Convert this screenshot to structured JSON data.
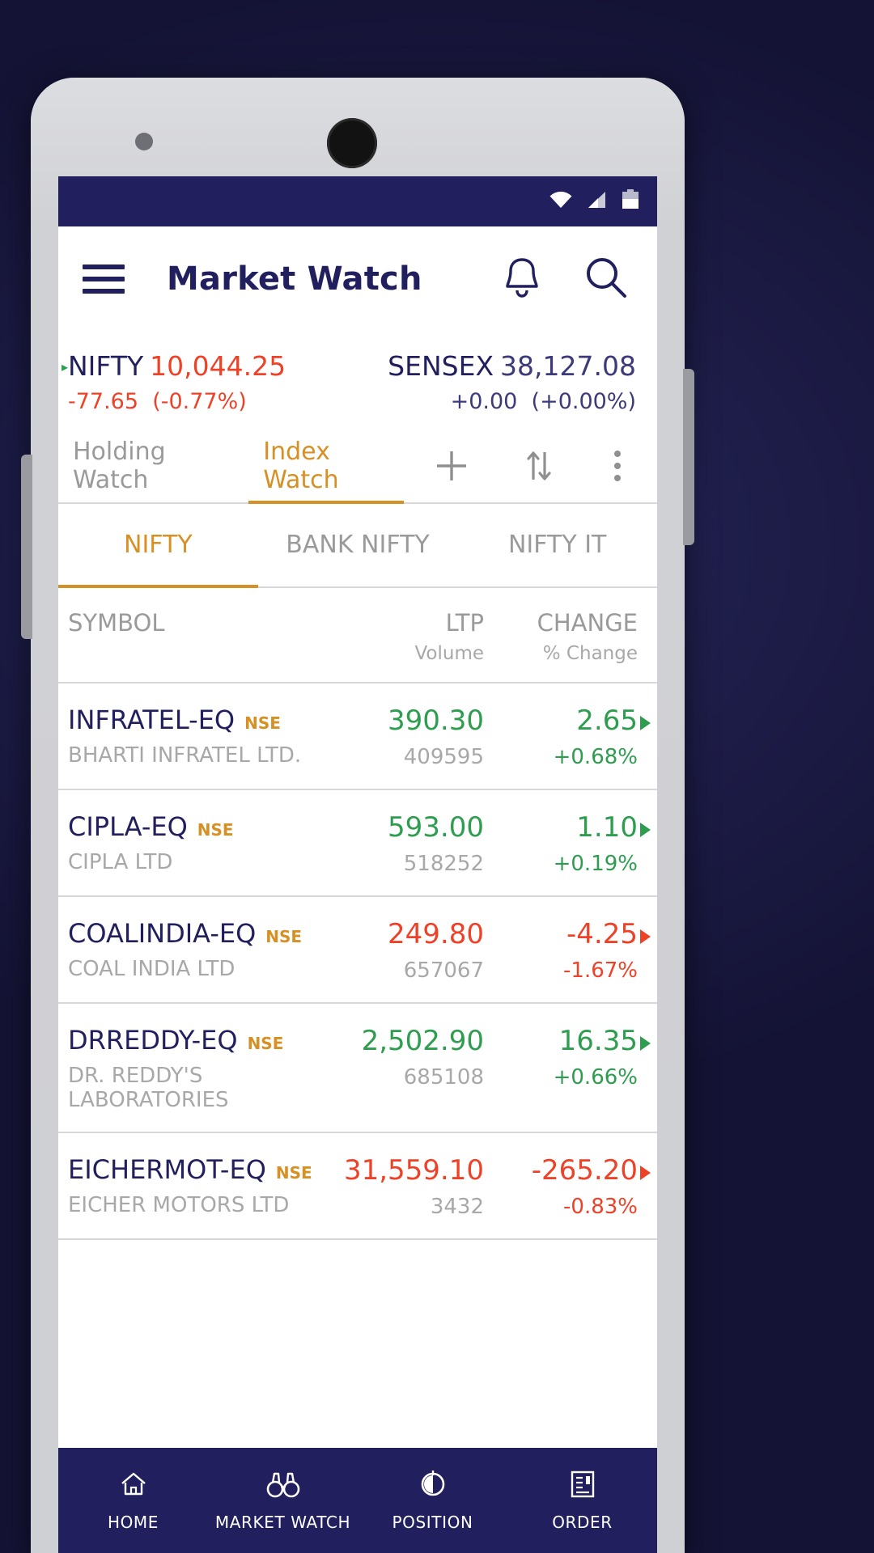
{
  "statusbar": {
    "icons": [
      "wifi-icon",
      "signal-icon",
      "battery-icon"
    ]
  },
  "appbar": {
    "title": "Market Watch",
    "menu_icon": "hamburger-icon",
    "bell_icon": "bell-icon",
    "search_icon": "search-icon"
  },
  "ticker": {
    "nifty": {
      "name": "NIFTY",
      "value": "10,044.25",
      "change": "-77.65",
      "percent": "(-0.77%)"
    },
    "sensex": {
      "name": "SENSEX",
      "value": "38,127.08",
      "change": "+0.00",
      "percent": "(+0.00%)"
    }
  },
  "watch_tabs": {
    "holding": "Holding Watch",
    "index": "Index Watch",
    "add_icon": "plus-icon",
    "sort_icon": "sort-arrows-icon",
    "more_icon": "more-vertical-icon"
  },
  "index_tabs": [
    {
      "label": "NIFTY",
      "active": true
    },
    {
      "label": "BANK NIFTY",
      "active": false
    },
    {
      "label": "NIFTY IT",
      "active": false
    }
  ],
  "columns": {
    "symbol": "SYMBOL",
    "ltp": "LTP",
    "volume": "Volume",
    "change": "CHANGE",
    "pct_change": "% Change"
  },
  "colors": {
    "brand_navy": "#211f5e",
    "accent_orange": "#d79024",
    "up_green": "#2e9d4f",
    "down_red": "#ee4228",
    "muted_grey": "#a8a8a8"
  },
  "rows": [
    {
      "symbol": "INFRATEL-EQ",
      "exchange": "NSE",
      "name": "BHARTI INFRATEL LTD.",
      "ltp": "390.30",
      "volume": "409595",
      "change": "2.65",
      "pct": "+0.68%",
      "dir": "up"
    },
    {
      "symbol": "CIPLA-EQ",
      "exchange": "NSE",
      "name": "CIPLA LTD",
      "ltp": "593.00",
      "volume": "518252",
      "change": "1.10",
      "pct": "+0.19%",
      "dir": "up"
    },
    {
      "symbol": "COALINDIA-EQ",
      "exchange": "NSE",
      "name": "COAL INDIA LTD",
      "ltp": "249.80",
      "volume": "657067",
      "change": "-4.25",
      "pct": "-1.67%",
      "dir": "down"
    },
    {
      "symbol": "DRREDDY-EQ",
      "exchange": "NSE",
      "name": "DR. REDDY'S LABORATORIES",
      "ltp": "2,502.90",
      "volume": "685108",
      "change": "16.35",
      "pct": "+0.66%",
      "dir": "up"
    },
    {
      "symbol": "EICHERMOT-EQ",
      "exchange": "NSE",
      "name": "EICHER MOTORS LTD",
      "ltp": "31,559.10",
      "volume": "3432",
      "change": "-265.20",
      "pct": "-0.83%",
      "dir": "down"
    }
  ],
  "bottom_nav": [
    {
      "label": "HOME",
      "icon": "home-icon"
    },
    {
      "label": "MARKET WATCH",
      "icon": "binoculars-icon"
    },
    {
      "label": "POSITION",
      "icon": "position-icon"
    },
    {
      "label": "ORDER",
      "icon": "order-list-icon"
    }
  ]
}
